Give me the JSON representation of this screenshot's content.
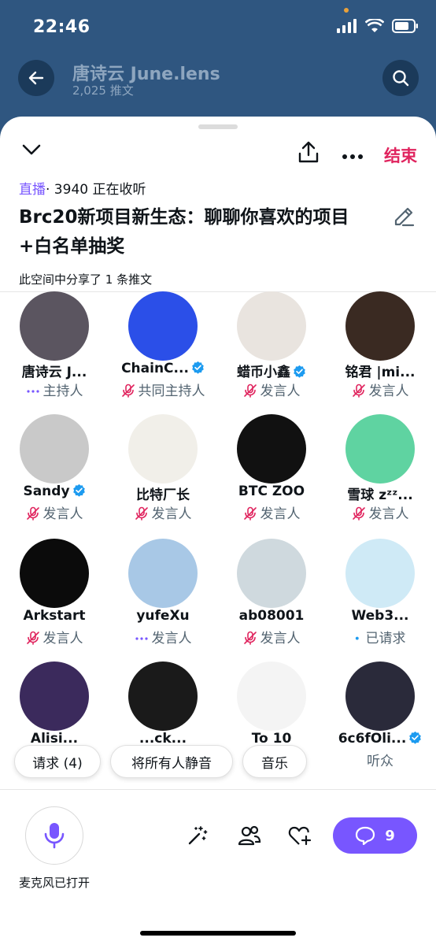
{
  "status_bar": {
    "time": "22:46"
  },
  "profile": {
    "name": "唐诗云 June.lens",
    "posts": "2,025 推文"
  },
  "header": {
    "end_label": "结束"
  },
  "space": {
    "live_tag": "直播",
    "listening": "· 3940 正在收听",
    "title": "Brc20新项目新生态：聊聊你喜欢的项目+白名单抽奖",
    "shared": "此空间中分享了 1 条推文"
  },
  "participants": [
    {
      "name": "唐诗云 J...",
      "role": "主持人",
      "verified": false,
      "role_icon": "dots-icon",
      "avatar_color": "#5b5560"
    },
    {
      "name": "ChainC...",
      "role": "共同主持人",
      "verified": true,
      "role_icon": "mic-muted-icon",
      "avatar_color": "#2b4fe8"
    },
    {
      "name": "蜡币小鑫",
      "role": "发言人",
      "verified": true,
      "role_icon": "mic-muted-icon",
      "avatar_color": "#e9e4df"
    },
    {
      "name": "铭君 |mi...",
      "role": "发言人",
      "verified": false,
      "role_icon": "mic-muted-icon",
      "avatar_color": "#3a2a22"
    },
    {
      "name": "Sandy",
      "role": "发言人",
      "verified": true,
      "role_icon": "mic-muted-icon",
      "avatar_color": "#c9c9c9"
    },
    {
      "name": "比特厂长",
      "role": "发言人",
      "verified": false,
      "role_icon": "mic-muted-icon",
      "avatar_color": "#f1efe9"
    },
    {
      "name": "BTC ZOO",
      "role": "发言人",
      "verified": false,
      "role_icon": "mic-muted-icon",
      "avatar_color": "#111111"
    },
    {
      "name": "雪球 zᶻᶻ...",
      "role": "发言人",
      "verified": false,
      "role_icon": "mic-muted-icon",
      "avatar_color": "#5fd3a1"
    },
    {
      "name": "Arkstart",
      "role": "发言人",
      "verified": false,
      "role_icon": "mic-muted-icon",
      "avatar_color": "#0b0b0b"
    },
    {
      "name": "yufeXu",
      "role": "发言人",
      "verified": false,
      "role_icon": "dots-icon",
      "avatar_color": "#a8c8e6"
    },
    {
      "name": "ab08001",
      "role": "发言人",
      "verified": false,
      "role_icon": "mic-muted-icon",
      "avatar_color": "#cfd9de"
    },
    {
      "name": "Web3...",
      "role": "已请求",
      "verified": false,
      "role_icon": "dot-icon",
      "avatar_color": "#cfeaf6"
    },
    {
      "name": "Alisi...",
      "role": "",
      "verified": false,
      "role_icon": "",
      "avatar_color": "#3b2a5c"
    },
    {
      "name": "...ck...",
      "role": "",
      "verified": false,
      "role_icon": "",
      "avatar_color": "#1a1a1a"
    },
    {
      "name": "To 10",
      "role": "",
      "verified": false,
      "role_icon": "",
      "avatar_color": "#f4f4f4"
    },
    {
      "name": "6c6fOli...",
      "role": "听众",
      "verified": true,
      "role_icon": "",
      "avatar_color": "#2a2a3a"
    }
  ],
  "pills": {
    "requests": "请求 (4)",
    "mute_all": "将所有人静音",
    "music": "音乐"
  },
  "bottom": {
    "mic_label": "麦克风已打开",
    "chat_count": "9"
  },
  "colors": {
    "accent": "#7856ff",
    "end": "#e0245e",
    "verified": "#1d9bf0",
    "muted": "#e0245e"
  }
}
